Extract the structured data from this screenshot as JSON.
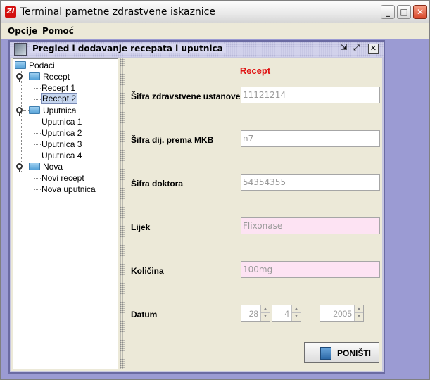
{
  "window": {
    "title": "Terminal pametne zdrastvene iskaznice",
    "icon": "app-logo-icon",
    "controls": [
      "minimize-icon",
      "maximize-icon",
      "close-icon"
    ]
  },
  "menu": {
    "items": [
      "Opcije",
      "Pomoć"
    ]
  },
  "internal_frame": {
    "title": "Pregled i dodavanje recepata i uputnica"
  },
  "tree": {
    "root": "Podaci",
    "groups": [
      {
        "label": "Recept",
        "children": [
          "Recept 1",
          "Recept 2"
        ]
      },
      {
        "label": "Uputnica",
        "children": [
          "Uputnica 1",
          "Uputnica 2",
          "Uputnica 3",
          "Uputnica 4"
        ]
      },
      {
        "label": "Nova",
        "children": [
          "Novi recept",
          "Nova uputnica"
        ]
      }
    ],
    "selected": "Recept 2"
  },
  "form": {
    "title": "Recept",
    "fields": [
      {
        "label": "Šifra zdravstvene ustanove",
        "value": "11121214"
      },
      {
        "label": "Šifra dij. prema MKB",
        "value": "n7"
      },
      {
        "label": "Šifra doktora",
        "value": "54354355"
      },
      {
        "label": "Lijek",
        "value": "Flixonase"
      },
      {
        "label": "Količina",
        "value": "100mg"
      }
    ],
    "date": {
      "label": "Datum",
      "day": "28",
      "month": "4",
      "year": "2005"
    },
    "button_label": "PONIŠTI",
    "highlight_color": "#fde3f3",
    "title_color": "#e01212"
  }
}
